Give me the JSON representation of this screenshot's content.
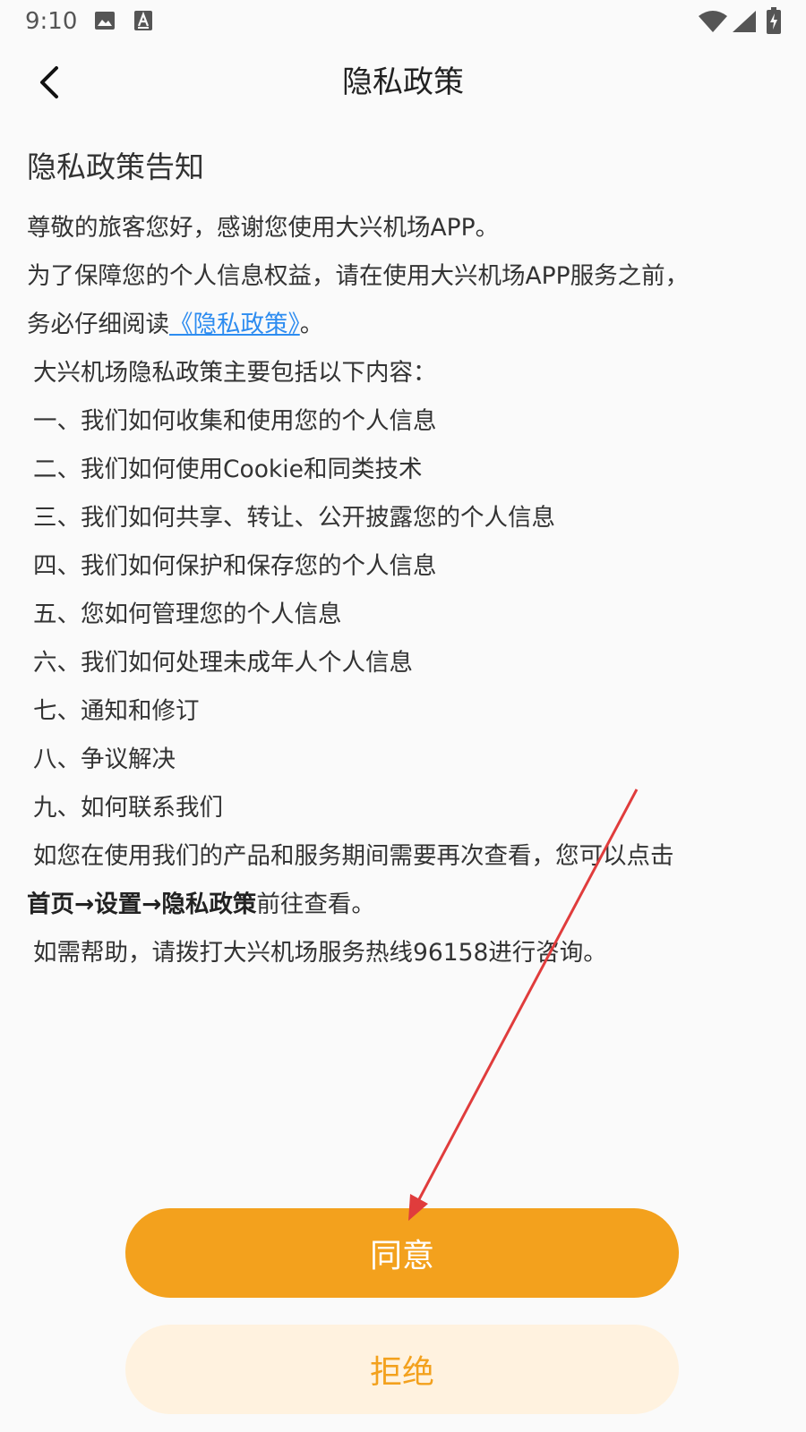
{
  "status_bar": {
    "time": "9:10",
    "icons": [
      "image-icon",
      "a-notification-icon",
      "wifi-icon",
      "signal-icon",
      "battery-charging-icon"
    ]
  },
  "header": {
    "title": "隐私政策",
    "back_icon": "chevron-left-icon"
  },
  "content": {
    "notice_title": "隐私政策告知",
    "greeting": "尊敬的旅客您好，感谢您使用大兴机场APP。",
    "intro_line1": "为了保障您的个人信息权益，请在使用大兴机场APP服务之前，",
    "intro_line2_prefix": "务必仔细阅读",
    "policy_link": "《隐私政策》",
    "intro_line2_suffix": "。",
    "list_heading": "大兴机场隐私政策主要包括以下内容：",
    "items": [
      "一、我们如何收集和使用您的个人信息",
      "二、我们如何使用Cookie和同类技术",
      "三、我们如何共享、转让、公开披露您的个人信息",
      "四、我们如何保护和保存您的个人信息",
      "五、您如何管理您的个人信息",
      "六、我们如何处理未成年人个人信息",
      "七、通知和修订",
      "八、争议解决",
      "九、如何联系我们"
    ],
    "review_line1": "如您在使用我们的产品和服务期间需要再次查看，您可以点击",
    "review_path": "首页→设置→隐私政策",
    "review_suffix": "前往查看。",
    "help_line": "如需帮助，请拨打大兴机场服务热线96158进行咨询。"
  },
  "buttons": {
    "agree_label": "同意",
    "refuse_label": "拒绝"
  },
  "colors": {
    "accent": "#f3a11d",
    "refuse_bg": "#fff2df",
    "link": "#2d8cf0",
    "annotation_arrow": "#e03c3c"
  }
}
